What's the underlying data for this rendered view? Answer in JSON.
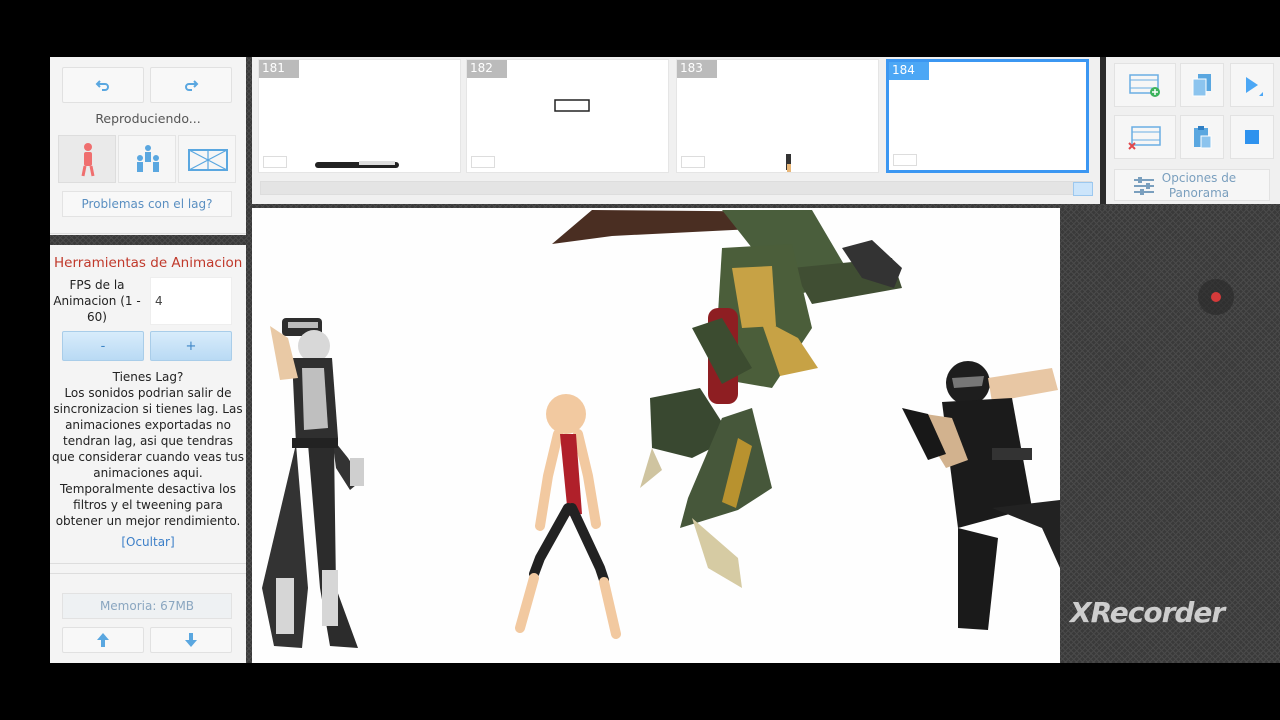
{
  "status": {
    "playing": "Reproduciendo..."
  },
  "toolbar": {
    "undo_icon": "undo-icon",
    "redo_icon": "redo-icon"
  },
  "modes": [
    "figure-mode-icon",
    "group-mode-icon",
    "scene-mode-icon"
  ],
  "lag_button": "Problemas con el lag?",
  "tools": {
    "title": "Herramientas de Animacion",
    "fps_label": "FPS de la Animacion (1 - 60)",
    "fps_value": "4",
    "minus": "-",
    "plus": "+"
  },
  "lag_info": {
    "heading": "Tienes Lag?",
    "body": "Los sonidos podrian salir de sincronizacion si tienes lag. Las animaciones exportadas no tendran lag, asi que tendras que considerar cuando veas tus animaciones aqui. Temporalmente desactiva los filtros y el tweening para obtener un mejor rendimiento.",
    "hide_link": "[Ocultar]"
  },
  "memory": "Memoria: 67MB",
  "frames": [
    {
      "number": "181",
      "selected": false
    },
    {
      "number": "182",
      "selected": false
    },
    {
      "number": "183",
      "selected": false
    },
    {
      "number": "184",
      "selected": true
    }
  ],
  "right_panel": {
    "icons": [
      "add-frame-icon",
      "copy-icon",
      "play-icon",
      "delete-frame-icon",
      "paste-icon",
      "stop-icon"
    ],
    "panorama": "Opciones de Panorama"
  },
  "watermark": "XRecorder",
  "colors": {
    "accent": "#3b97f2",
    "title_red": "#c0392b",
    "link": "#3c7fc8"
  }
}
